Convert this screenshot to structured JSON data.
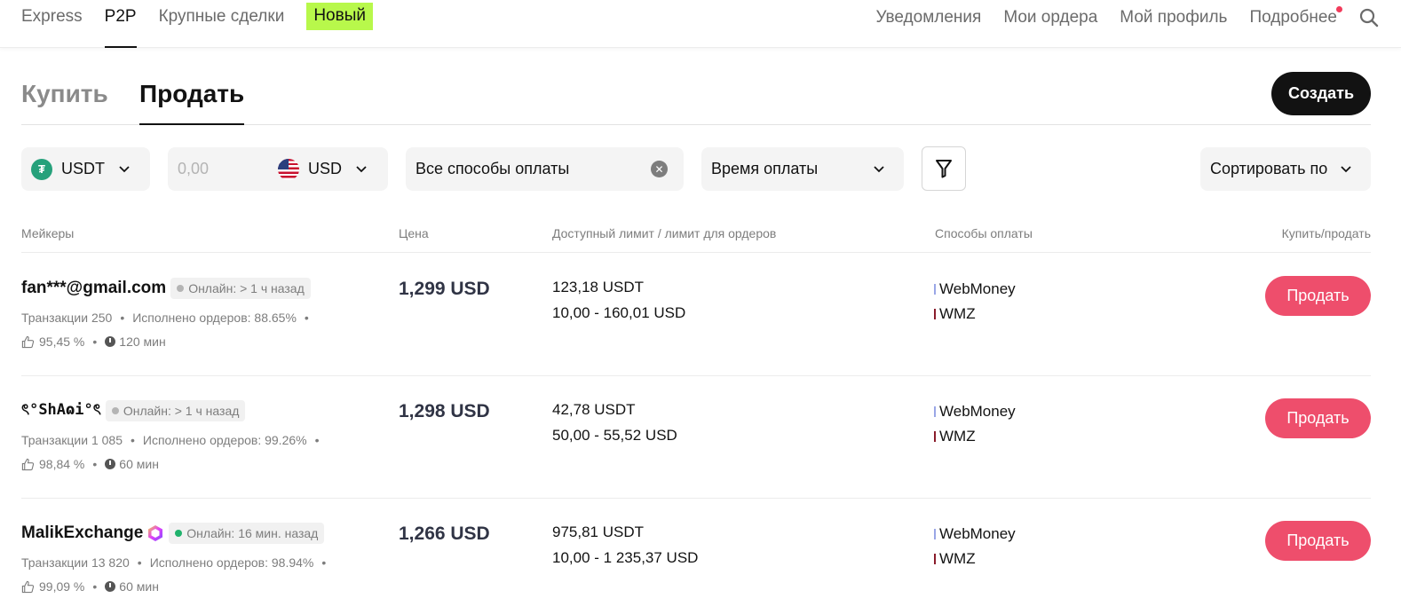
{
  "topnav": {
    "tabs": [
      "Express",
      "P2P",
      "Крупные сделки",
      "Новый"
    ],
    "active": "P2P",
    "right": [
      "Уведомления",
      "Мои ордера",
      "Мой профиль",
      "Подробнее"
    ]
  },
  "trade_tabs": {
    "buy": "Купить",
    "sell": "Продать",
    "active": "Продать"
  },
  "create_label": "Создать",
  "filters": {
    "coin": "USDT",
    "coin_icon": "tether-icon",
    "amount_placeholder": "0,00",
    "fiat": "USD",
    "fiat_icon": "us-flag-icon",
    "payment": "Все способы оплаты",
    "time": "Время оплаты",
    "sort": "Сортировать по"
  },
  "columns": [
    "Мейкеры",
    "Цена",
    "Доступный лимит / лимит для ордеров",
    "Способы оплаты",
    "Купить/продать"
  ],
  "rows": [
    {
      "maker": "fan***@gmail.com",
      "online": "Онлайн: > 1 ч назад",
      "online_status": "offline",
      "transactions": "Транзакции 250",
      "completed": "Исполнено ордеров: 88.65%",
      "rating": "95,45 %",
      "time": "120 мин",
      "price": "1,299 USD",
      "available": "123,18 USDT",
      "limit": "10,00 - 160,01 USD",
      "payments": [
        "WebMoney",
        "WMZ"
      ],
      "action": "Продать"
    },
    {
      "maker": "ৎ°ShΑɷi°ৎ",
      "online": "Онлайн: > 1 ч назад",
      "online_status": "offline",
      "transactions": "Транзакции 1 085",
      "completed": "Исполнено ордеров: 99.26%",
      "rating": "98,84 %",
      "time": "60 мин",
      "price": "1,298 USD",
      "available": "42,78 USDT",
      "limit": "50,00 - 55,52 USD",
      "payments": [
        "WebMoney",
        "WMZ"
      ],
      "action": "Продать"
    },
    {
      "maker": "MalikExchange",
      "online": "Онлайн: 16 мин. назад",
      "online_status": "online",
      "transactions": "Транзакции 13 820",
      "completed": "Исполнено ордеров: 98.94%",
      "rating": "99,09 %",
      "time": "60 мин",
      "price": "1,266 USD",
      "available": "975,81 USDT",
      "limit": "10,00 - 1 235,37 USD",
      "payments": [
        "WebMoney",
        "WMZ"
      ],
      "action": "Продать"
    }
  ],
  "colors": {
    "accent_new": "#b8f84b",
    "sell_button": "#ee4e6c",
    "webmoney_bar": "#9aa6e6",
    "wmz_bar": "#8a1c2b",
    "online_green": "#20b26c",
    "notification_dot": "#f23b5b"
  }
}
